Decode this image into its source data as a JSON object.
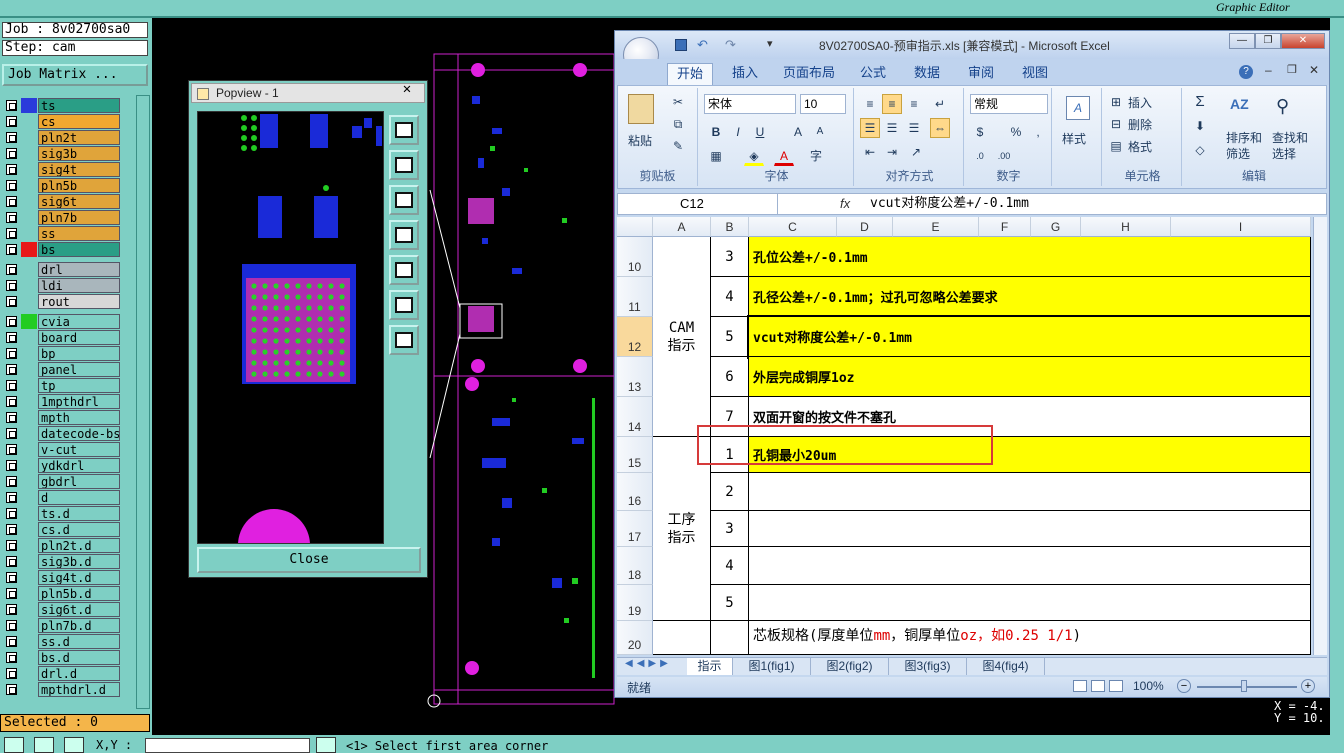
{
  "genesis": {
    "job": "Job : 8v02700sa0",
    "step": "Step: cam",
    "job_matrix": "Job Matrix ...",
    "graphic_editor": "Graphic Editor",
    "selected": "Selected : 0",
    "xy_label": "X,Y :",
    "prompt": "<1>  Select first area corner",
    "coord_x": "X = -4.",
    "coord_y": "Y = 10.",
    "layers": [
      {
        "name": "ts",
        "bg": "#2a9e86",
        "color": "#2a3bdb",
        "active": true
      },
      {
        "name": "cs",
        "bg": "#f0a830",
        "color": ""
      },
      {
        "name": "pln2t",
        "bg": "#e0a43a",
        "color": ""
      },
      {
        "name": "sig3b",
        "bg": "#e0a43a",
        "color": ""
      },
      {
        "name": "sig4t",
        "bg": "#e0a43a",
        "color": ""
      },
      {
        "name": "pln5b",
        "bg": "#e0a43a",
        "color": ""
      },
      {
        "name": "sig6t",
        "bg": "#e0a43a",
        "color": ""
      },
      {
        "name": "pln7b",
        "bg": "#e0a43a",
        "color": ""
      },
      {
        "name": "ss",
        "bg": "#e0a43a",
        "color": ""
      },
      {
        "name": "bs",
        "bg": "#2a9e86",
        "color": "#e81818",
        "active": true
      },
      {
        "name": "drl",
        "bg": "#a9b6bc",
        "color": ""
      },
      {
        "name": "ldi",
        "bg": "#a9b6bc",
        "color": ""
      },
      {
        "name": "rout",
        "bg": "#d7d7d7",
        "color": ""
      },
      {
        "name": "cvia",
        "bg": "#7ecfc4",
        "color": "#22cc22"
      },
      {
        "name": "board",
        "bg": "#7ecfc4",
        "color": ""
      },
      {
        "name": "bp",
        "bg": "#7ecfc4",
        "color": ""
      },
      {
        "name": "panel",
        "bg": "#7ecfc4",
        "color": ""
      },
      {
        "name": "tp",
        "bg": "#7ecfc4",
        "color": ""
      },
      {
        "name": "1mpthdrl",
        "bg": "#7ecfc4",
        "color": ""
      },
      {
        "name": "mpth",
        "bg": "#7ecfc4",
        "color": ""
      },
      {
        "name": "datecode-bs",
        "bg": "#7ecfc4",
        "color": ""
      },
      {
        "name": "v-cut",
        "bg": "#7ecfc4",
        "color": ""
      },
      {
        "name": "ydkdrl",
        "bg": "#7ecfc4",
        "color": ""
      },
      {
        "name": "gbdrl",
        "bg": "#7ecfc4",
        "color": ""
      },
      {
        "name": "d",
        "bg": "#7ecfc4",
        "color": ""
      },
      {
        "name": "ts.d",
        "bg": "#7ecfc4",
        "color": ""
      },
      {
        "name": "cs.d",
        "bg": "#7ecfc4",
        "color": ""
      },
      {
        "name": "pln2t.d",
        "bg": "#7ecfc4",
        "color": ""
      },
      {
        "name": "sig3b.d",
        "bg": "#7ecfc4",
        "color": ""
      },
      {
        "name": "sig4t.d",
        "bg": "#7ecfc4",
        "color": ""
      },
      {
        "name": "pln5b.d",
        "bg": "#7ecfc4",
        "color": ""
      },
      {
        "name": "sig6t.d",
        "bg": "#7ecfc4",
        "color": ""
      },
      {
        "name": "pln7b.d",
        "bg": "#7ecfc4",
        "color": ""
      },
      {
        "name": "ss.d",
        "bg": "#7ecfc4",
        "color": ""
      },
      {
        "name": "bs.d",
        "bg": "#7ecfc4",
        "color": ""
      },
      {
        "name": "drl.d",
        "bg": "#7ecfc4",
        "color": ""
      },
      {
        "name": "mpthdrl.d",
        "bg": "#7ecfc4",
        "color": ""
      }
    ]
  },
  "popview": {
    "title": "Popview - 1",
    "close_x": "✕",
    "close_button": "Close",
    "tools": [
      "zoom-in-icon",
      "pan-up-icon",
      "pan-down-icon",
      "pan-left-icon",
      "pan-right-icon",
      "zoom-fit-icon",
      "zoom-home-icon"
    ]
  },
  "excel": {
    "title": "8V02700SA0-预审指示.xls  [兼容模式] - Microsoft Excel",
    "tabs": [
      "开始",
      "插入",
      "页面布局",
      "公式",
      "数据",
      "审阅",
      "视图"
    ],
    "ribbon": {
      "paste": "粘贴",
      "clipboard": "剪贴板",
      "font_name": "宋体",
      "font_size": "10",
      "font_group": "字体",
      "bold": "B",
      "italic": "I",
      "underline": "U",
      "grow": "A",
      "shrink": "A",
      "align_group": "对齐方式",
      "number_format": "常规",
      "percent": "%",
      "comma": ",",
      "number_group": "数字",
      "styles": "样式",
      "insert": "插入",
      "delete": "删除",
      "format": "格式",
      "cells_group": "单元格",
      "sigma": "Σ",
      "sort": "排序和\n筛选",
      "find": "查找和\n选择",
      "edit_group": "编辑"
    },
    "name_box": "C12",
    "fx": "fx",
    "formula": "vcut对称度公差+/-0.1mm",
    "columns": [
      "A",
      "B",
      "C",
      "D",
      "E",
      "F",
      "G",
      "H",
      "I"
    ],
    "rows": [
      {
        "row": "10",
        "num": "3",
        "text": "孔位公差+/-0.1mm",
        "yellow": true
      },
      {
        "row": "11",
        "num": "4",
        "text": "孔径公差+/-0.1mm；过孔可忽略公差要求",
        "yellow": true
      },
      {
        "row": "12",
        "num": "5",
        "text": "vcut对称度公差+/-0.1mm",
        "yellow": true,
        "selected": true
      },
      {
        "row": "13",
        "num": "6",
        "text": "外层完成铜厚1oz",
        "yellow": true
      },
      {
        "row": "14",
        "num": "7",
        "text": "双面开窗的按文件不塞孔",
        "yellow": false
      },
      {
        "row": "15",
        "num": "1",
        "text": "孔铜最小20um",
        "yellow": true
      },
      {
        "row": "16",
        "num": "2",
        "text": "",
        "yellow": false
      },
      {
        "row": "17",
        "num": "3",
        "text": "",
        "yellow": false
      },
      {
        "row": "18",
        "num": "4",
        "text": "",
        "yellow": false
      },
      {
        "row": "19",
        "num": "5",
        "text": "",
        "yellow": false
      },
      {
        "row": "20",
        "num": "",
        "text": "芯板规格(厚度单位",
        "yellow": false
      }
    ],
    "group_cam": "CAM\n指示",
    "group_process": "工序\n指示",
    "row20_mm": "mm",
    "row20_mid": "，铜厚单位",
    "row20_oz": "oz，如0.25 1/1",
    "row20_end": ")",
    "sheets": [
      "指示",
      "图1(fig1)",
      "图2(fig2)",
      "图3(fig3)",
      "图4(fig4)"
    ],
    "status": "就绪",
    "zoom": "100%"
  }
}
